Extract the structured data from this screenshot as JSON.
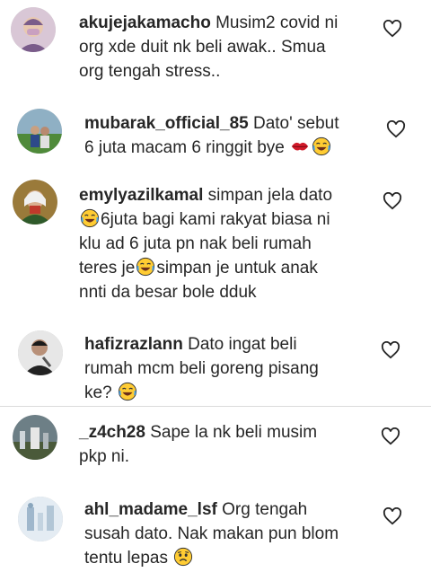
{
  "comments": [
    {
      "username": "akujejakamacho",
      "lines": [
        "Musim2 covid ni",
        "org xde duit nk beli awak.. Smua",
        "org tengah stress.."
      ],
      "colors": {
        "bg": "#d9c7d6",
        "face": "#7a5c8a"
      }
    },
    {
      "username": "mubarak_official_85",
      "lines": [
        "Dato' sebut",
        "6 juta macam 6 ringgit bye"
      ],
      "emoji": [
        "kiss-lips-emoji",
        "laughing-tears-emoji"
      ],
      "colors": {
        "bg": "#8fb0c4",
        "face": "#3c6b2e"
      }
    },
    {
      "username": "emylyazilkamal",
      "lines": [
        "simpan jela dato",
        "6juta bagi kami rakyat biasa ni",
        "klu ad 6 juta pn nak beli rumah",
        "teres je",
        "simpan je untuk anak",
        "nnti da besar bole dduk"
      ],
      "colors": {
        "bg": "#9a7a3a",
        "face": "#2f5a2a"
      }
    },
    {
      "username": "hafizrazlann",
      "lines": [
        "Dato ingat beli",
        "rumah mcm beli goreng pisang",
        "ke?"
      ],
      "colors": {
        "bg": "#e7e7e7",
        "face": "#222222"
      }
    },
    {
      "username": "_z4ch28",
      "lines": [
        "Sape la nk beli musim",
        "pkp ni."
      ],
      "colors": {
        "bg": "#6d7f86",
        "face": "#4a5a3a"
      }
    },
    {
      "username": "ahl_madame_lsf",
      "lines": [
        "Org tengah",
        "susah dato. Nak makan pun blom",
        "tentu lepas"
      ],
      "colors": {
        "bg": "#e4ecf3",
        "face": "#9fb7cc"
      }
    }
  ]
}
